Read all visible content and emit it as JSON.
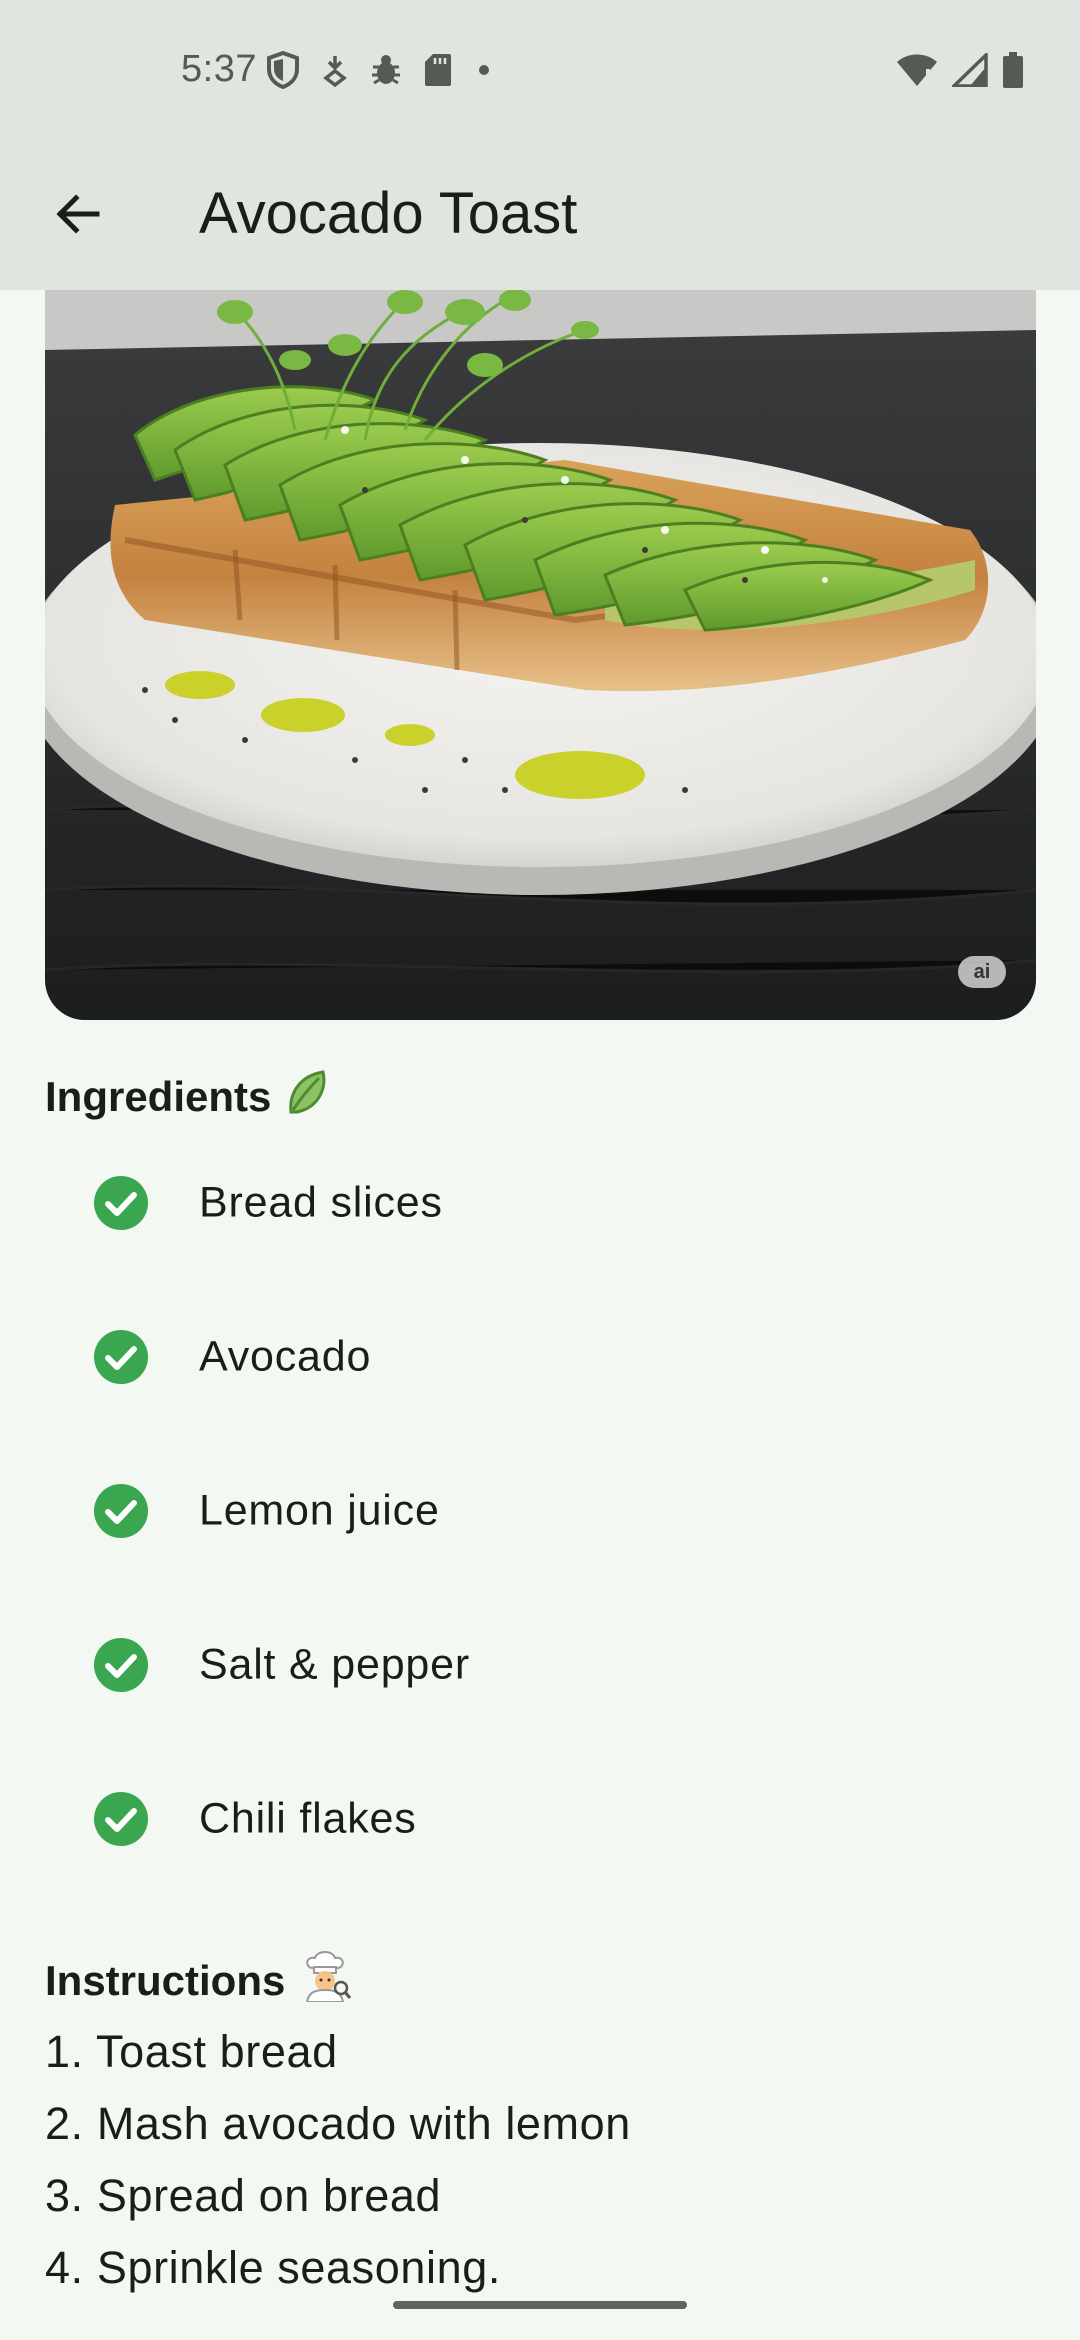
{
  "status_bar": {
    "time": "5:37",
    "left_icons": [
      "shield-icon",
      "download-arrow-icon",
      "bug-icon",
      "sd-card-icon",
      "dot-icon"
    ],
    "right_icons": [
      "wifi-icon",
      "cell-signal-icon",
      "battery-icon"
    ]
  },
  "app_bar": {
    "title": "Avocado Toast",
    "back_icon": "arrow-back-icon"
  },
  "hero": {
    "description_icon": "avocado-toast-photo",
    "badge": "ai"
  },
  "ingredients": {
    "heading": "Ingredients",
    "heading_icon": "leafy-green-icon",
    "check_icon": "check-circle-icon",
    "check_color": "#3aa64f",
    "items": [
      {
        "label": "Bread slices"
      },
      {
        "label": "Avocado"
      },
      {
        "label": "Lemon juice"
      },
      {
        "label": "Salt & pepper"
      },
      {
        "label": "Chili flakes"
      }
    ]
  },
  "instructions": {
    "heading": "Instructions",
    "heading_icon": "cook-icon",
    "steps": [
      "1. Toast bread",
      "2. Mash avocado with lemon",
      "3. Spread on bread",
      "4. Sprinkle seasoning."
    ]
  }
}
